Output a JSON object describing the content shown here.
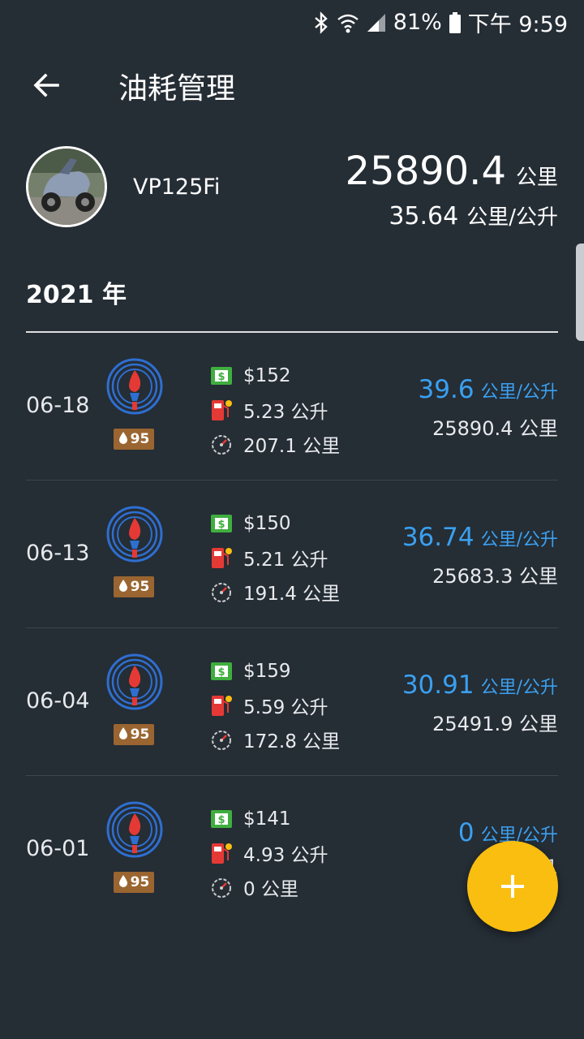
{
  "status_bar": {
    "battery": "81%",
    "time": "下午 9:59"
  },
  "header": {
    "title": "油耗管理"
  },
  "vehicle": {
    "name": "VP125Fi",
    "odometer": "25890.4",
    "odometer_unit": "公里",
    "avg_efficiency": "35.64",
    "avg_unit": "公里/公升"
  },
  "year_label": "2021 年",
  "records": [
    {
      "date": "06-18",
      "grade": "95",
      "price": "$152",
      "liters": "5.23 公升",
      "distance": "207.1 公里",
      "efficiency": "39.6",
      "efficiency_unit": "公里/公升",
      "odometer": "25890.4 公里"
    },
    {
      "date": "06-13",
      "grade": "95",
      "price": "$150",
      "liters": "5.21 公升",
      "distance": "191.4 公里",
      "efficiency": "36.74",
      "efficiency_unit": "公里/公升",
      "odometer": "25683.3 公里"
    },
    {
      "date": "06-04",
      "grade": "95",
      "price": "$159",
      "liters": "5.59 公升",
      "distance": "172.8 公里",
      "efficiency": "30.91",
      "efficiency_unit": "公里/公升",
      "odometer": "25491.9 公里"
    },
    {
      "date": "06-01",
      "grade": "95",
      "price": "$141",
      "liters": "4.93 公升",
      "distance": "0 公里",
      "efficiency": "0",
      "efficiency_unit": "公里/公升",
      "odometer": "2531"
    }
  ],
  "colors": {
    "background": "#252d35",
    "accent_blue": "#3aa0f0",
    "fab": "#f9be0f",
    "grade_badge": "#9a6530",
    "money_icon": "#3fae3f",
    "pump_icon": "#e53935"
  }
}
